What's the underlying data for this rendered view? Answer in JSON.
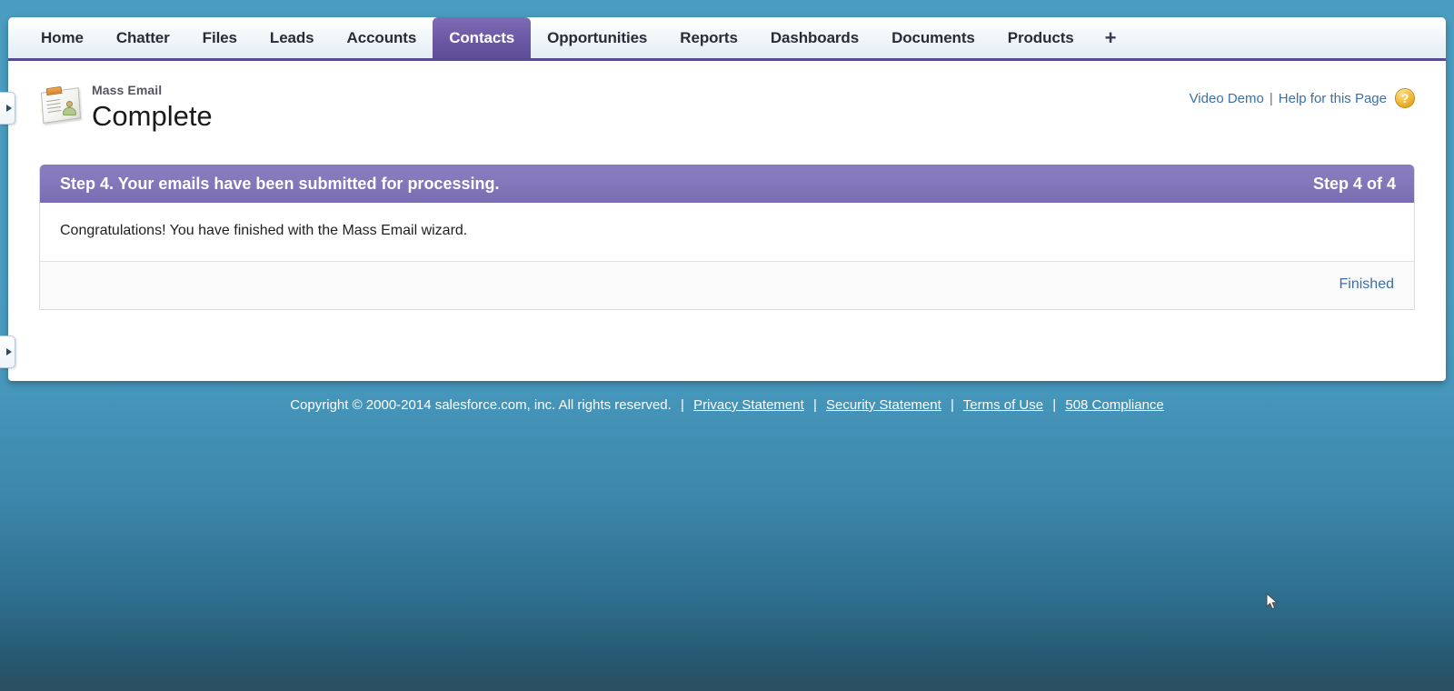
{
  "tabs": [
    {
      "label": "Home",
      "active": false
    },
    {
      "label": "Chatter",
      "active": false
    },
    {
      "label": "Files",
      "active": false
    },
    {
      "label": "Leads",
      "active": false
    },
    {
      "label": "Accounts",
      "active": false
    },
    {
      "label": "Contacts",
      "active": true
    },
    {
      "label": "Opportunities",
      "active": false
    },
    {
      "label": "Reports",
      "active": false
    },
    {
      "label": "Dashboards",
      "active": false
    },
    {
      "label": "Documents",
      "active": false
    },
    {
      "label": "Products",
      "active": false
    }
  ],
  "tab_add_label": "+",
  "page": {
    "subtitle": "Mass Email",
    "title": "Complete",
    "icon": "contact-card-icon"
  },
  "help": {
    "video_demo": "Video Demo",
    "separator": "|",
    "help_for_page": "Help for this Page",
    "badge_glyph": "?"
  },
  "wizard": {
    "step_heading": "Step 4. Your emails have been submitted for processing.",
    "step_counter": "Step 4 of 4",
    "message": "Congratulations! You have finished with the Mass Email wizard.",
    "finish_label": "Finished",
    "header_color": "#8377b9"
  },
  "footer": {
    "copyright": "Copyright © 2000-2014 salesforce.com, inc. All rights reserved.",
    "sep": "|",
    "links": [
      "Privacy Statement",
      "Security Statement",
      "Terms of Use",
      "508 Compliance"
    ]
  },
  "sidebar_toggles": [
    {
      "name": "sidebar-expand-top"
    },
    {
      "name": "sidebar-expand-bottom"
    }
  ]
}
